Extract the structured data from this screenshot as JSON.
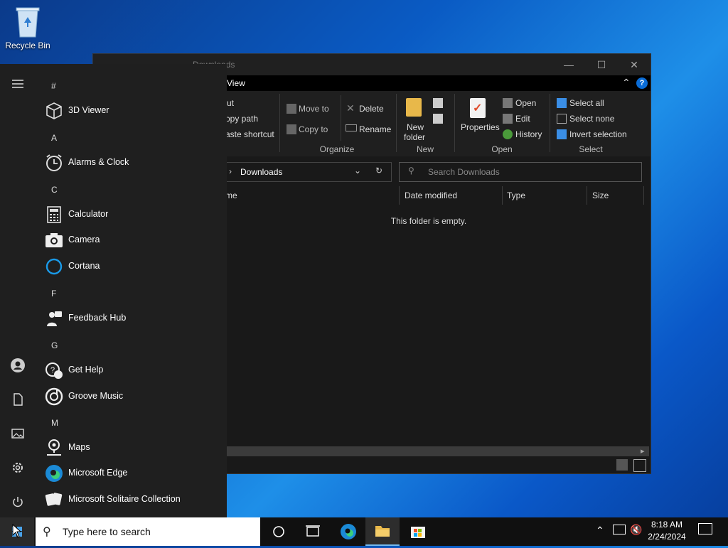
{
  "desktop": {
    "recycle_bin_label": "Recycle Bin"
  },
  "explorer": {
    "title": "Downloads",
    "menu_view": "View",
    "ribbon": {
      "clipboard": {
        "cut": "ut",
        "copy_path": "opy path",
        "paste_shortcut": "aste shortcut"
      },
      "organize": {
        "move_to": "Move to",
        "copy_to": "Copy to",
        "delete": "Delete",
        "rename": "Rename",
        "group_label": "Organize"
      },
      "new": {
        "new_folder_line1": "New",
        "new_folder_line2": "folder",
        "group_label": "New"
      },
      "open": {
        "properties": "Properties",
        "open": "Open",
        "edit": "Edit",
        "history": "History",
        "group_label": "Open"
      },
      "select": {
        "select_all": "Select all",
        "select_none": "Select none",
        "invert_selection": "Invert selection",
        "group_label": "Select"
      }
    },
    "address": {
      "path": "Downloads"
    },
    "search": {
      "placeholder": "Search Downloads"
    },
    "columns": {
      "name": "me",
      "date_modified": "Date modified",
      "type": "Type",
      "size": "Size"
    },
    "empty_message": "This folder is empty."
  },
  "start_menu": {
    "sections": [
      {
        "letter": "#",
        "apps": [
          {
            "name": "3D Viewer",
            "icon": "3d-viewer-icon"
          }
        ]
      },
      {
        "letter": "A",
        "apps": [
          {
            "name": "Alarms & Clock",
            "icon": "alarm-clock-icon"
          }
        ]
      },
      {
        "letter": "C",
        "apps": [
          {
            "name": "Calculator",
            "icon": "calculator-icon"
          },
          {
            "name": "Camera",
            "icon": "camera-icon"
          },
          {
            "name": "Cortana",
            "icon": "cortana-icon"
          }
        ]
      },
      {
        "letter": "F",
        "apps": [
          {
            "name": "Feedback Hub",
            "icon": "feedback-hub-icon"
          }
        ]
      },
      {
        "letter": "G",
        "apps": [
          {
            "name": "Get Help",
            "icon": "get-help-icon"
          },
          {
            "name": "Groove Music",
            "icon": "groove-music-icon"
          }
        ]
      },
      {
        "letter": "M",
        "apps": [
          {
            "name": "Maps",
            "icon": "maps-icon"
          },
          {
            "name": "Microsoft Edge",
            "icon": "edge-icon"
          },
          {
            "name": "Microsoft Solitaire Collection",
            "icon": "solitaire-icon"
          }
        ]
      }
    ]
  },
  "taskbar": {
    "search_placeholder": "Type here to search",
    "time": "8:18 AM",
    "date": "2/24/2024"
  },
  "colors": {
    "accent": "#0078d7",
    "start_bg": "#1f1f1f",
    "taskbar_bg": "#101010"
  }
}
